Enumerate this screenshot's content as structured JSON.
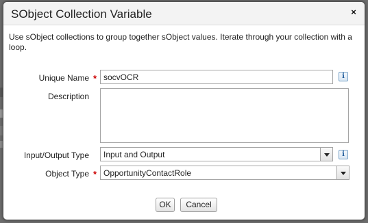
{
  "dialog": {
    "title": "SObject Collection Variable",
    "close_glyph": "×",
    "intro": "Use sObject collections to group together sObject values. Iterate through your collection with a loop."
  },
  "form": {
    "unique_name": {
      "label": "Unique Name",
      "required_mark": "*",
      "value": "socvOCR",
      "info_glyph": "i"
    },
    "description": {
      "label": "Description",
      "value": ""
    },
    "io_type": {
      "label": "Input/Output Type",
      "selected": "Input and Output",
      "info_glyph": "i"
    },
    "object_type": {
      "label": "Object Type",
      "required_mark": "*",
      "value": "OpportunityContactRole"
    }
  },
  "buttons": {
    "ok": "OK",
    "cancel": "Cancel"
  },
  "colors": {
    "required": "#cc0000",
    "info": "#1f5b9a",
    "overlay": "#6d6d6d"
  }
}
